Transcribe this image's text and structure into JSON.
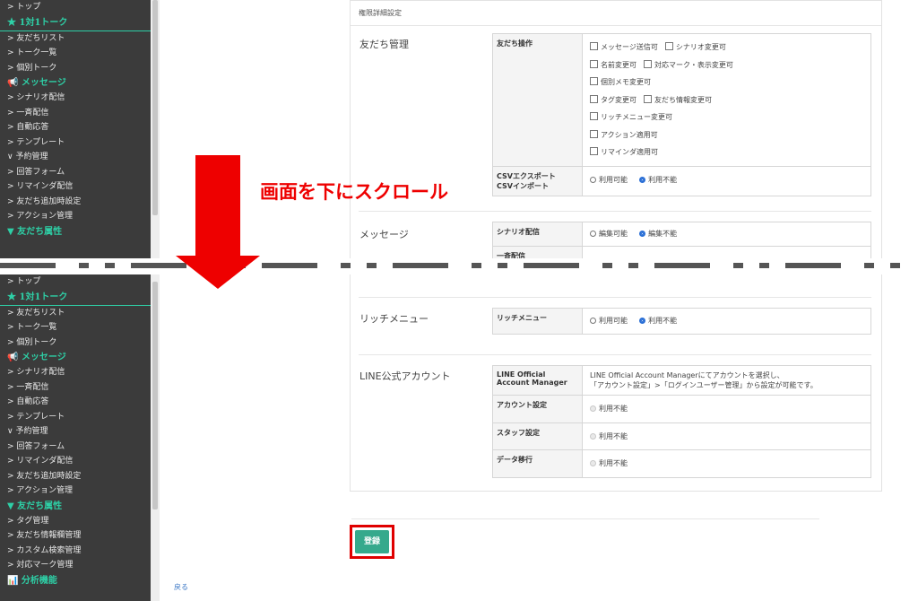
{
  "annotation": {
    "scroll_text": "画面を下にスクロール"
  },
  "sidebar_top": {
    "items": [
      {
        "kind": "item",
        "label": "> トップ"
      },
      {
        "kind": "head",
        "label": "★ 1対1トーク",
        "line": true
      },
      {
        "kind": "item",
        "label": "> 友だちリスト"
      },
      {
        "kind": "item",
        "label": "> トーク一覧"
      },
      {
        "kind": "item",
        "label": "> 個別トーク"
      },
      {
        "kind": "head",
        "label": "📢 メッセージ"
      },
      {
        "kind": "item",
        "label": "> シナリオ配信"
      },
      {
        "kind": "item",
        "label": "> 一斉配信"
      },
      {
        "kind": "item",
        "label": "> 自動応答"
      },
      {
        "kind": "item",
        "label": "> テンプレート"
      },
      {
        "kind": "item",
        "label": "∨ 予約管理"
      },
      {
        "kind": "item",
        "label": "> 回答フォーム"
      },
      {
        "kind": "item",
        "label": "> リマインダ配信"
      },
      {
        "kind": "item",
        "label": "> 友だち追加時設定"
      },
      {
        "kind": "item",
        "label": "> アクション管理"
      },
      {
        "kind": "head",
        "label": "▼ 友だち属性"
      }
    ]
  },
  "sidebar_bottom": {
    "items": [
      {
        "kind": "item",
        "label": "> トップ"
      },
      {
        "kind": "head",
        "label": "★ 1対1トーク",
        "line": true
      },
      {
        "kind": "item",
        "label": "> 友だちリスト"
      },
      {
        "kind": "item",
        "label": "> トーク一覧"
      },
      {
        "kind": "item",
        "label": "> 個別トーク"
      },
      {
        "kind": "head",
        "label": "📢 メッセージ"
      },
      {
        "kind": "item",
        "label": "> シナリオ配信"
      },
      {
        "kind": "item",
        "label": "> 一斉配信"
      },
      {
        "kind": "item",
        "label": "> 自動応答"
      },
      {
        "kind": "item",
        "label": "> テンプレート"
      },
      {
        "kind": "item",
        "label": "∨ 予約管理"
      },
      {
        "kind": "item",
        "label": "> 回答フォーム"
      },
      {
        "kind": "item",
        "label": "> リマインダ配信"
      },
      {
        "kind": "item",
        "label": "> 友だち追加時設定"
      },
      {
        "kind": "item",
        "label": "> アクション管理"
      },
      {
        "kind": "head",
        "label": "▼ 友だち属性"
      },
      {
        "kind": "item",
        "label": "> タグ管理"
      },
      {
        "kind": "item",
        "label": "> 友だち情報欄管理"
      },
      {
        "kind": "item",
        "label": "> カスタム検索管理"
      },
      {
        "kind": "item",
        "label": "> 対応マーク管理"
      },
      {
        "kind": "head",
        "label": "📊 分析機能"
      }
    ]
  },
  "panel_title": "権限詳細設定",
  "friends": {
    "label": "友だち管理",
    "op_key": "友だち操作",
    "op_lines": [
      [
        "メッセージ送信可",
        "シナリオ変更可"
      ],
      [
        "名前変更可",
        "対応マーク・表示変更可"
      ],
      [
        "個別メモ変更可"
      ],
      [
        "タグ変更可",
        "友だち情報変更可"
      ],
      [
        "リッチメニュー変更可"
      ],
      [
        "アクション適用可"
      ],
      [
        "リマインダ適用可"
      ]
    ],
    "csv_key_1": "CSVエクスポート",
    "csv_key_2": "CSVインポート",
    "csv_opt_1": "利用可能",
    "csv_opt_2": "利用不能"
  },
  "message": {
    "label": "メッセージ",
    "row1_key": "シナリオ配信",
    "row1_opt_1": "編集可能",
    "row1_opt_2": "編集不能",
    "row2_key_partial": "一斉配信"
  },
  "richmenu": {
    "label": "リッチメニュー",
    "key": "リッチメニュー",
    "opt_1": "利用可能",
    "opt_2": "利用不能"
  },
  "line": {
    "label": "LINE公式アカウント",
    "row0_key": "LINE Official Account Manager",
    "row0_text_1": "LINE Official Account Managerにてアカウントを選択し、",
    "row0_text_2": "「アカウント設定」>「ログインユーザー管理」から設定が可能です。",
    "row1_key": "アカウント設定",
    "row2_key": "スタッフ設定",
    "row3_key": "データ移行",
    "disabled_opt": "利用不能"
  },
  "submit_label": "登録",
  "back_label": "戻る"
}
